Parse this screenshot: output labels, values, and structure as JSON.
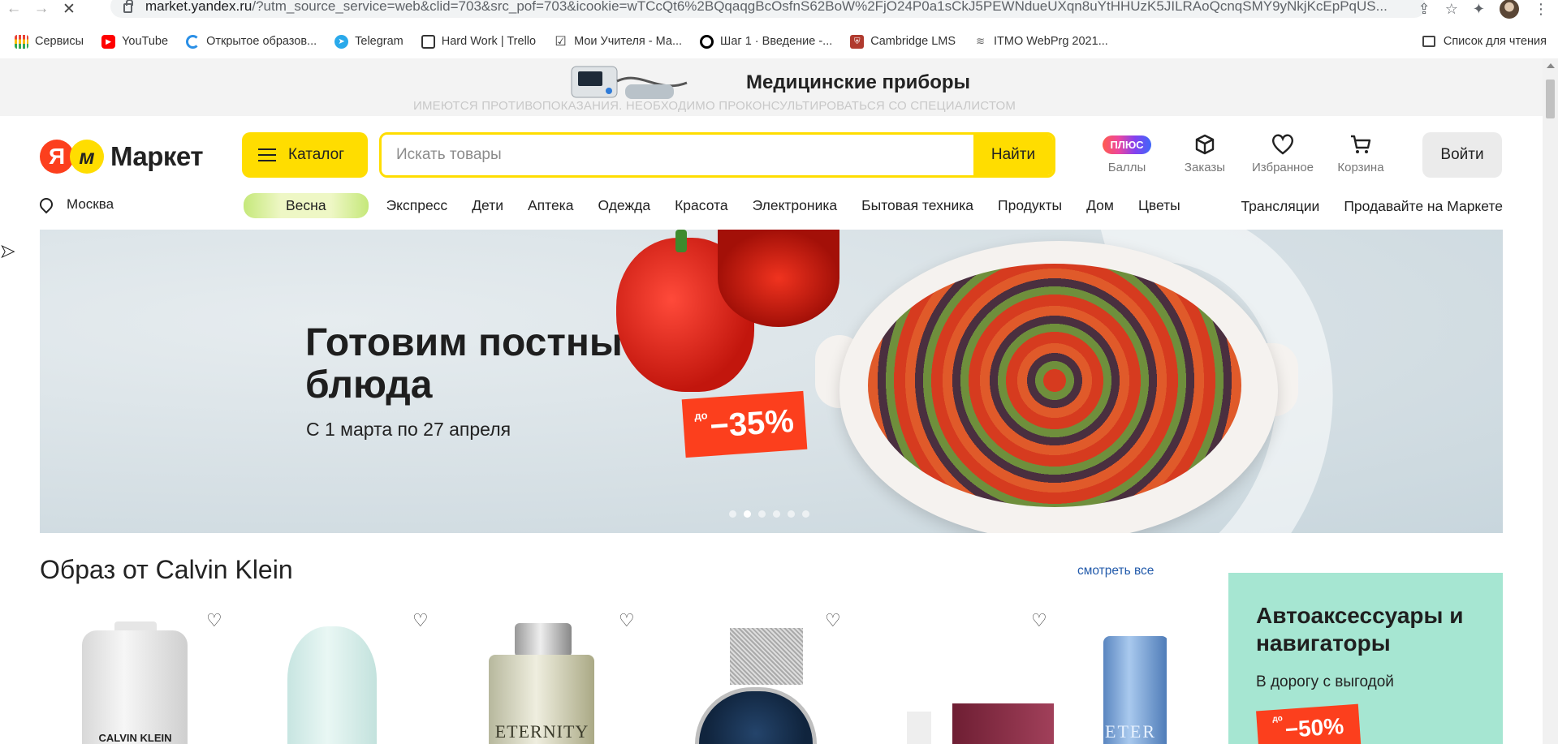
{
  "browser": {
    "url_host": "market.yandex.ru",
    "url_rest": "/?utm_source_service=web&clid=703&src_pof=703&icookie=wTCcQt6%2BQqaqgBcOsfnS62BoW%2FjO24P0a1sCkJ5PEWNdueUXqn8uYtHHUzK5JILRAoQcnqSMY9yNkjKcEpPqUS...",
    "bookmarks": [
      {
        "label": "Сервисы",
        "icon": "apps-grid-icon"
      },
      {
        "label": "YouTube",
        "icon": "youtube-icon"
      },
      {
        "label": "Открытое образов...",
        "icon": "ring-icon"
      },
      {
        "label": "Telegram",
        "icon": "telegram-icon"
      },
      {
        "label": "Hard Work | Trello",
        "icon": "trello-icon"
      },
      {
        "label": "Мои Учителя - Ма...",
        "icon": "checkbox-icon"
      },
      {
        "label": "Шаг 1 · Введение -...",
        "icon": "step-icon"
      },
      {
        "label": "Cambridge LMS",
        "icon": "cambridge-icon"
      },
      {
        "label": "ITMO WebPrg 2021...",
        "icon": "itmo-icon"
      }
    ],
    "reading_list": "Список для чтения"
  },
  "promo": {
    "title": "Медицинские приборы",
    "warning": "ИМЕЮТСЯ ПРОТИВОПОКАЗАНИЯ. НЕОБХОДИМО ПРОКОНСУЛЬТИРОВАТЬСЯ СО СПЕЦИАЛИСТОМ"
  },
  "header": {
    "logo_mark": "Я",
    "logo_text": "Маркет",
    "catalog_label": "Каталог",
    "search_placeholder": "Искать товары",
    "search_button": "Найти",
    "plus_badge": "ПЛЮС",
    "icons": [
      {
        "label": "Баллы",
        "icon": "plus-badge-icon"
      },
      {
        "label": "Заказы",
        "icon": "box-icon"
      },
      {
        "label": "Избранное",
        "icon": "heart-icon"
      },
      {
        "label": "Корзина",
        "icon": "cart-icon"
      }
    ],
    "login": "Войти"
  },
  "nav": {
    "city": "Москва",
    "categories": [
      "Весна",
      "Экспресс",
      "Дети",
      "Аптека",
      "Одежда",
      "Красота",
      "Электроника",
      "Бытовая техника",
      "Продукты",
      "Дом",
      "Цветы"
    ],
    "right_links": [
      "Трансляции",
      "Продавайте на Маркете"
    ]
  },
  "banner": {
    "title": "Готовим постные блюда",
    "subtitle": "С 1 марта по 27 апреля",
    "discount_prefix": "до",
    "discount": "−35%",
    "slides": 6,
    "active_slide": 2
  },
  "section": {
    "title": "Образ от Calvin Klein",
    "see_all": "смотреть все",
    "product_labels": [
      "CALVIN KLEIN",
      "ETERNITY",
      "ETER"
    ]
  },
  "ad": {
    "title": "Автоаксессуары и навигаторы",
    "subtitle": "В дорогу с выгодой",
    "discount_prefix": "до",
    "discount": "−50%"
  }
}
